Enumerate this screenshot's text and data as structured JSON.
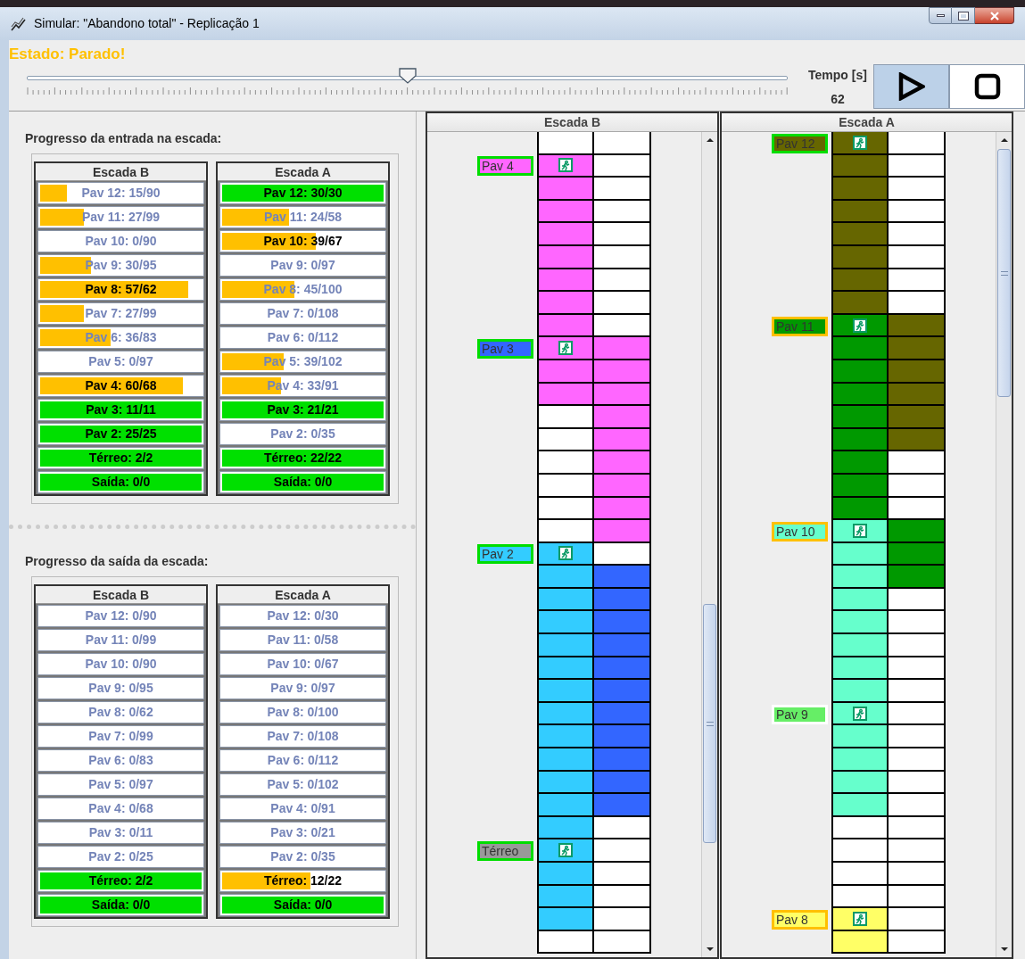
{
  "window": {
    "title": "Simular: \"Abandono total\" - Replicação 1"
  },
  "status": "Estado: Parado!",
  "slider": {
    "level": 0.5
  },
  "time": {
    "label": "Tempo [s]",
    "value": "62"
  },
  "buttons": [
    {
      "kind": "play",
      "selected": true
    },
    {
      "kind": "stop",
      "selected": false
    }
  ],
  "progress_sections": [
    {
      "title": "Progresso da entrada na escada:",
      "tables": [
        {
          "header": "Escada B",
          "rows": [
            {
              "label": "Pav 12: 15/90",
              "level": 0.167
            },
            {
              "label": "Pav 11: 27/99",
              "level": 0.273
            },
            {
              "label": "Pav 10: 0/90",
              "level": 0
            },
            {
              "label": "Pav 9: 30/95",
              "level": 0.316
            },
            {
              "label": "Pav 8: 57/62",
              "level": 0.919
            },
            {
              "label": "Pav 7: 27/99",
              "level": 0.273
            },
            {
              "label": "Pav 6: 36/83",
              "level": 0.434
            },
            {
              "label": "Pav 5: 0/97",
              "level": 0
            },
            {
              "label": "Pav 4: 60/68",
              "level": 0.882
            },
            {
              "label": "Pav 3: 11/11",
              "level": 1
            },
            {
              "label": "Pav 2: 25/25",
              "level": 1
            },
            {
              "label": "Térreo: 2/2",
              "level": 1
            },
            {
              "label": "Saída: 0/0",
              "level": 1
            }
          ]
        },
        {
          "header": "Escada A",
          "rows": [
            {
              "label": "Pav 12: 30/30",
              "level": 1
            },
            {
              "label": "Pav 11: 24/58",
              "level": 0.414
            },
            {
              "label": "Pav 10: 39/67",
              "level": 0.582
            },
            {
              "label": "Pav 9: 0/97",
              "level": 0
            },
            {
              "label": "Pav 8: 45/100",
              "level": 0.45
            },
            {
              "label": "Pav 7: 0/108",
              "level": 0
            },
            {
              "label": "Pav 6: 0/112",
              "level": 0
            },
            {
              "label": "Pav 5: 39/102",
              "level": 0.382
            },
            {
              "label": "Pav 4: 33/91",
              "level": 0.363
            },
            {
              "label": "Pav 3: 21/21",
              "level": 1
            },
            {
              "label": "Pav 2: 0/35",
              "level": 0
            },
            {
              "label": "Térreo: 22/22",
              "level": 1
            },
            {
              "label": "Saída: 0/0",
              "level": 1
            }
          ]
        }
      ]
    },
    {
      "title": "Progresso da saída da escada:",
      "tables": [
        {
          "header": "Escada B",
          "rows": [
            {
              "label": "Pav 12: 0/90",
              "level": 0
            },
            {
              "label": "Pav 11: 0/99",
              "level": 0
            },
            {
              "label": "Pav 10: 0/90",
              "level": 0
            },
            {
              "label": "Pav 9: 0/95",
              "level": 0
            },
            {
              "label": "Pav 8: 0/62",
              "level": 0
            },
            {
              "label": "Pav 7: 0/99",
              "level": 0
            },
            {
              "label": "Pav 6: 0/83",
              "level": 0
            },
            {
              "label": "Pav 5: 0/97",
              "level": 0
            },
            {
              "label": "Pav 4: 0/68",
              "level": 0
            },
            {
              "label": "Pav 3: 0/11",
              "level": 0
            },
            {
              "label": "Pav 2: 0/25",
              "level": 0
            },
            {
              "label": "Térreo: 2/2",
              "level": 1
            },
            {
              "label": "Saída: 0/0",
              "level": 1
            }
          ]
        },
        {
          "header": "Escada A",
          "rows": [
            {
              "label": "Pav 12: 0/30",
              "level": 0
            },
            {
              "label": "Pav 11: 0/58",
              "level": 0
            },
            {
              "label": "Pav 10: 0/67",
              "level": 0
            },
            {
              "label": "Pav 9: 0/97",
              "level": 0
            },
            {
              "label": "Pav 8: 0/100",
              "level": 0
            },
            {
              "label": "Pav 7: 0/108",
              "level": 0
            },
            {
              "label": "Pav 6: 0/112",
              "level": 0
            },
            {
              "label": "Pav 5: 0/102",
              "level": 0
            },
            {
              "label": "Pav 4: 0/91",
              "level": 0
            },
            {
              "label": "Pav 3: 0/21",
              "level": 0
            },
            {
              "label": "Pav 2: 0/35",
              "level": 0
            },
            {
              "label": "Térreo: 12/22",
              "level": 0.545
            },
            {
              "label": "Saída: 0/0",
              "level": 1
            }
          ]
        }
      ]
    }
  ],
  "stairs": [
    {
      "header": "Escada B",
      "rows": [
        {
          "cells": [
            {
              "color": "#ffffff"
            },
            {
              "color": "#ffffff"
            }
          ]
        },
        {
          "label": {
            "text": "Pav 4",
            "color": "#ff66ff",
            "frame": {
              "color": "#00dd00"
            }
          },
          "cells": [
            {
              "color": "#ff66ff"
            },
            {
              "color": "#ffffff"
            }
          ]
        },
        {
          "cells": [
            {
              "color": "#ff66ff"
            },
            {
              "color": "#ffffff"
            }
          ]
        },
        {
          "cells": [
            {
              "color": "#ff66ff"
            },
            {
              "color": "#ffffff"
            }
          ]
        },
        {
          "cells": [
            {
              "color": "#ff66ff"
            },
            {
              "color": "#ffffff"
            }
          ]
        },
        {
          "cells": [
            {
              "color": "#ff66ff"
            },
            {
              "color": "#ffffff"
            }
          ]
        },
        {
          "cells": [
            {
              "color": "#ff66ff"
            },
            {
              "color": "#ffffff"
            }
          ]
        },
        {
          "cells": [
            {
              "color": "#ff66ff"
            },
            {
              "color": "#ffffff"
            }
          ]
        },
        {
          "cells": [
            {
              "color": "#ff66ff"
            },
            {
              "color": "#ffffff"
            }
          ]
        },
        {
          "label": {
            "text": "Pav 3",
            "color": "#3366ff",
            "frame": {
              "color": "#00dd00"
            }
          },
          "cells": [
            {
              "color": "#ff66ff"
            },
            {
              "color": "#ff66ff"
            }
          ]
        },
        {
          "cells": [
            {
              "color": "#ff66ff"
            },
            {
              "color": "#ff66ff"
            }
          ]
        },
        {
          "cells": [
            {
              "color": "#ff66ff"
            },
            {
              "color": "#ff66ff"
            }
          ]
        },
        {
          "cells": [
            {
              "color": "#ffffff"
            },
            {
              "color": "#ff66ff"
            }
          ]
        },
        {
          "cells": [
            {
              "color": "#ffffff"
            },
            {
              "color": "#ff66ff"
            }
          ]
        },
        {
          "cells": [
            {
              "color": "#ffffff"
            },
            {
              "color": "#ff66ff"
            }
          ]
        },
        {
          "cells": [
            {
              "color": "#ffffff"
            },
            {
              "color": "#ff66ff"
            }
          ]
        },
        {
          "cells": [
            {
              "color": "#ffffff"
            },
            {
              "color": "#ff66ff"
            }
          ]
        },
        {
          "cells": [
            {
              "color": "#ffffff"
            },
            {
              "color": "#ff66ff"
            }
          ]
        },
        {
          "label": {
            "text": "Pav 2",
            "color": "#33ccff",
            "frame": {
              "color": "#00dd00"
            }
          },
          "cells": [
            {
              "color": "#33ccff"
            },
            {
              "color": "#ffffff"
            }
          ]
        },
        {
          "cells": [
            {
              "color": "#33ccff"
            },
            {
              "color": "#3366ff"
            }
          ]
        },
        {
          "cells": [
            {
              "color": "#33ccff"
            },
            {
              "color": "#3366ff"
            }
          ]
        },
        {
          "cells": [
            {
              "color": "#33ccff"
            },
            {
              "color": "#3366ff"
            }
          ]
        },
        {
          "cells": [
            {
              "color": "#33ccff"
            },
            {
              "color": "#3366ff"
            }
          ]
        },
        {
          "cells": [
            {
              "color": "#33ccff"
            },
            {
              "color": "#3366ff"
            }
          ]
        },
        {
          "cells": [
            {
              "color": "#33ccff"
            },
            {
              "color": "#3366ff"
            }
          ]
        },
        {
          "cells": [
            {
              "color": "#33ccff"
            },
            {
              "color": "#3366ff"
            }
          ]
        },
        {
          "cells": [
            {
              "color": "#33ccff"
            },
            {
              "color": "#3366ff"
            }
          ]
        },
        {
          "cells": [
            {
              "color": "#33ccff"
            },
            {
              "color": "#3366ff"
            }
          ]
        },
        {
          "cells": [
            {
              "color": "#33ccff"
            },
            {
              "color": "#3366ff"
            }
          ]
        },
        {
          "cells": [
            {
              "color": "#33ccff"
            },
            {
              "color": "#3366ff"
            }
          ]
        },
        {
          "cells": [
            {
              "color": "#33ccff"
            },
            {
              "color": "#ffffff"
            }
          ]
        },
        {
          "label": {
            "text": "Térreo",
            "color": "#999999",
            "frame": {
              "color": "#00dd00"
            }
          },
          "cells": [
            {
              "color": "#33ccff"
            },
            {
              "color": "#ffffff"
            }
          ]
        },
        {
          "cells": [
            {
              "color": "#33ccff"
            },
            {
              "color": "#ffffff"
            }
          ]
        },
        {
          "cells": [
            {
              "color": "#33ccff"
            },
            {
              "color": "#ffffff"
            }
          ]
        },
        {
          "cells": [
            {
              "color": "#33ccff"
            },
            {
              "color": "#ffffff"
            }
          ]
        },
        {
          "cells": [
            {
              "color": "#ffffff"
            },
            {
              "color": "#ffffff"
            }
          ]
        }
      ]
    },
    {
      "header": "Escada A",
      "rows": [
        {
          "label": {
            "text": "Pav 12",
            "color": "#666600",
            "frame": {
              "color": "#00dd00"
            }
          },
          "cells": [
            {
              "color": "#666600"
            },
            {
              "color": "#ffffff"
            }
          ]
        },
        {
          "cells": [
            {
              "color": "#666600"
            },
            {
              "color": "#ffffff"
            }
          ]
        },
        {
          "cells": [
            {
              "color": "#666600"
            },
            {
              "color": "#ffffff"
            }
          ]
        },
        {
          "cells": [
            {
              "color": "#666600"
            },
            {
              "color": "#ffffff"
            }
          ]
        },
        {
          "cells": [
            {
              "color": "#666600"
            },
            {
              "color": "#ffffff"
            }
          ]
        },
        {
          "cells": [
            {
              "color": "#666600"
            },
            {
              "color": "#ffffff"
            }
          ]
        },
        {
          "cells": [
            {
              "color": "#666600"
            },
            {
              "color": "#ffffff"
            }
          ]
        },
        {
          "cells": [
            {
              "color": "#666600"
            },
            {
              "color": "#ffffff"
            }
          ]
        },
        {
          "label": {
            "text": "Pav 11",
            "color": "#009900",
            "frame": {
              "color": "#ffc000"
            }
          },
          "cells": [
            {
              "color": "#009900"
            },
            {
              "color": "#666600"
            }
          ]
        },
        {
          "cells": [
            {
              "color": "#009900"
            },
            {
              "color": "#666600"
            }
          ]
        },
        {
          "cells": [
            {
              "color": "#009900"
            },
            {
              "color": "#666600"
            }
          ]
        },
        {
          "cells": [
            {
              "color": "#009900"
            },
            {
              "color": "#666600"
            }
          ]
        },
        {
          "cells": [
            {
              "color": "#009900"
            },
            {
              "color": "#666600"
            }
          ]
        },
        {
          "cells": [
            {
              "color": "#009900"
            },
            {
              "color": "#666600"
            }
          ]
        },
        {
          "cells": [
            {
              "color": "#009900"
            },
            {
              "color": "#ffffff"
            }
          ]
        },
        {
          "cells": [
            {
              "color": "#009900"
            },
            {
              "color": "#ffffff"
            }
          ]
        },
        {
          "cells": [
            {
              "color": "#009900"
            },
            {
              "color": "#ffffff"
            }
          ]
        },
        {
          "label": {
            "text": "Pav 10",
            "color": "#66ffcc",
            "frame": {
              "color": "#ffc000"
            }
          },
          "cells": [
            {
              "color": "#66ffcc"
            },
            {
              "color": "#009900"
            }
          ]
        },
        {
          "cells": [
            {
              "color": "#66ffcc"
            },
            {
              "color": "#009900"
            }
          ]
        },
        {
          "cells": [
            {
              "color": "#66ffcc"
            },
            {
              "color": "#009900"
            }
          ]
        },
        {
          "cells": [
            {
              "color": "#66ffcc"
            },
            {
              "color": "#ffffff"
            }
          ]
        },
        {
          "cells": [
            {
              "color": "#66ffcc"
            },
            {
              "color": "#ffffff"
            }
          ]
        },
        {
          "cells": [
            {
              "color": "#66ffcc"
            },
            {
              "color": "#ffffff"
            }
          ]
        },
        {
          "cells": [
            {
              "color": "#66ffcc"
            },
            {
              "color": "#ffffff"
            }
          ]
        },
        {
          "cells": [
            {
              "color": "#66ffcc"
            },
            {
              "color": "#ffffff"
            }
          ]
        },
        {
          "label": {
            "text": "Pav 9",
            "color": "#66ee66",
            "frame": {
              "color": "#ffffff"
            }
          },
          "cells": [
            {
              "color": "#66ffcc"
            },
            {
              "color": "#ffffff"
            }
          ]
        },
        {
          "cells": [
            {
              "color": "#66ffcc"
            },
            {
              "color": "#ffffff"
            }
          ]
        },
        {
          "cells": [
            {
              "color": "#66ffcc"
            },
            {
              "color": "#ffffff"
            }
          ]
        },
        {
          "cells": [
            {
              "color": "#66ffcc"
            },
            {
              "color": "#ffffff"
            }
          ]
        },
        {
          "cells": [
            {
              "color": "#66ffcc"
            },
            {
              "color": "#ffffff"
            }
          ]
        },
        {
          "cells": [
            {
              "color": "#ffffff"
            },
            {
              "color": "#ffffff"
            }
          ]
        },
        {
          "cells": [
            {
              "color": "#ffffff"
            },
            {
              "color": "#ffffff"
            }
          ]
        },
        {
          "cells": [
            {
              "color": "#ffffff"
            },
            {
              "color": "#ffffff"
            }
          ]
        },
        {
          "cells": [
            {
              "color": "#ffffff"
            },
            {
              "color": "#ffffff"
            }
          ]
        },
        {
          "label": {
            "text": "Pav 8",
            "color": "#ffff66",
            "frame": {
              "color": "#ffc000"
            }
          },
          "cells": [
            {
              "color": "#ffff66"
            },
            {
              "color": "#ffffff"
            }
          ]
        },
        {
          "cells": [
            {
              "color": "#ffff66"
            },
            {
              "color": "#ffffff"
            }
          ]
        }
      ]
    }
  ]
}
